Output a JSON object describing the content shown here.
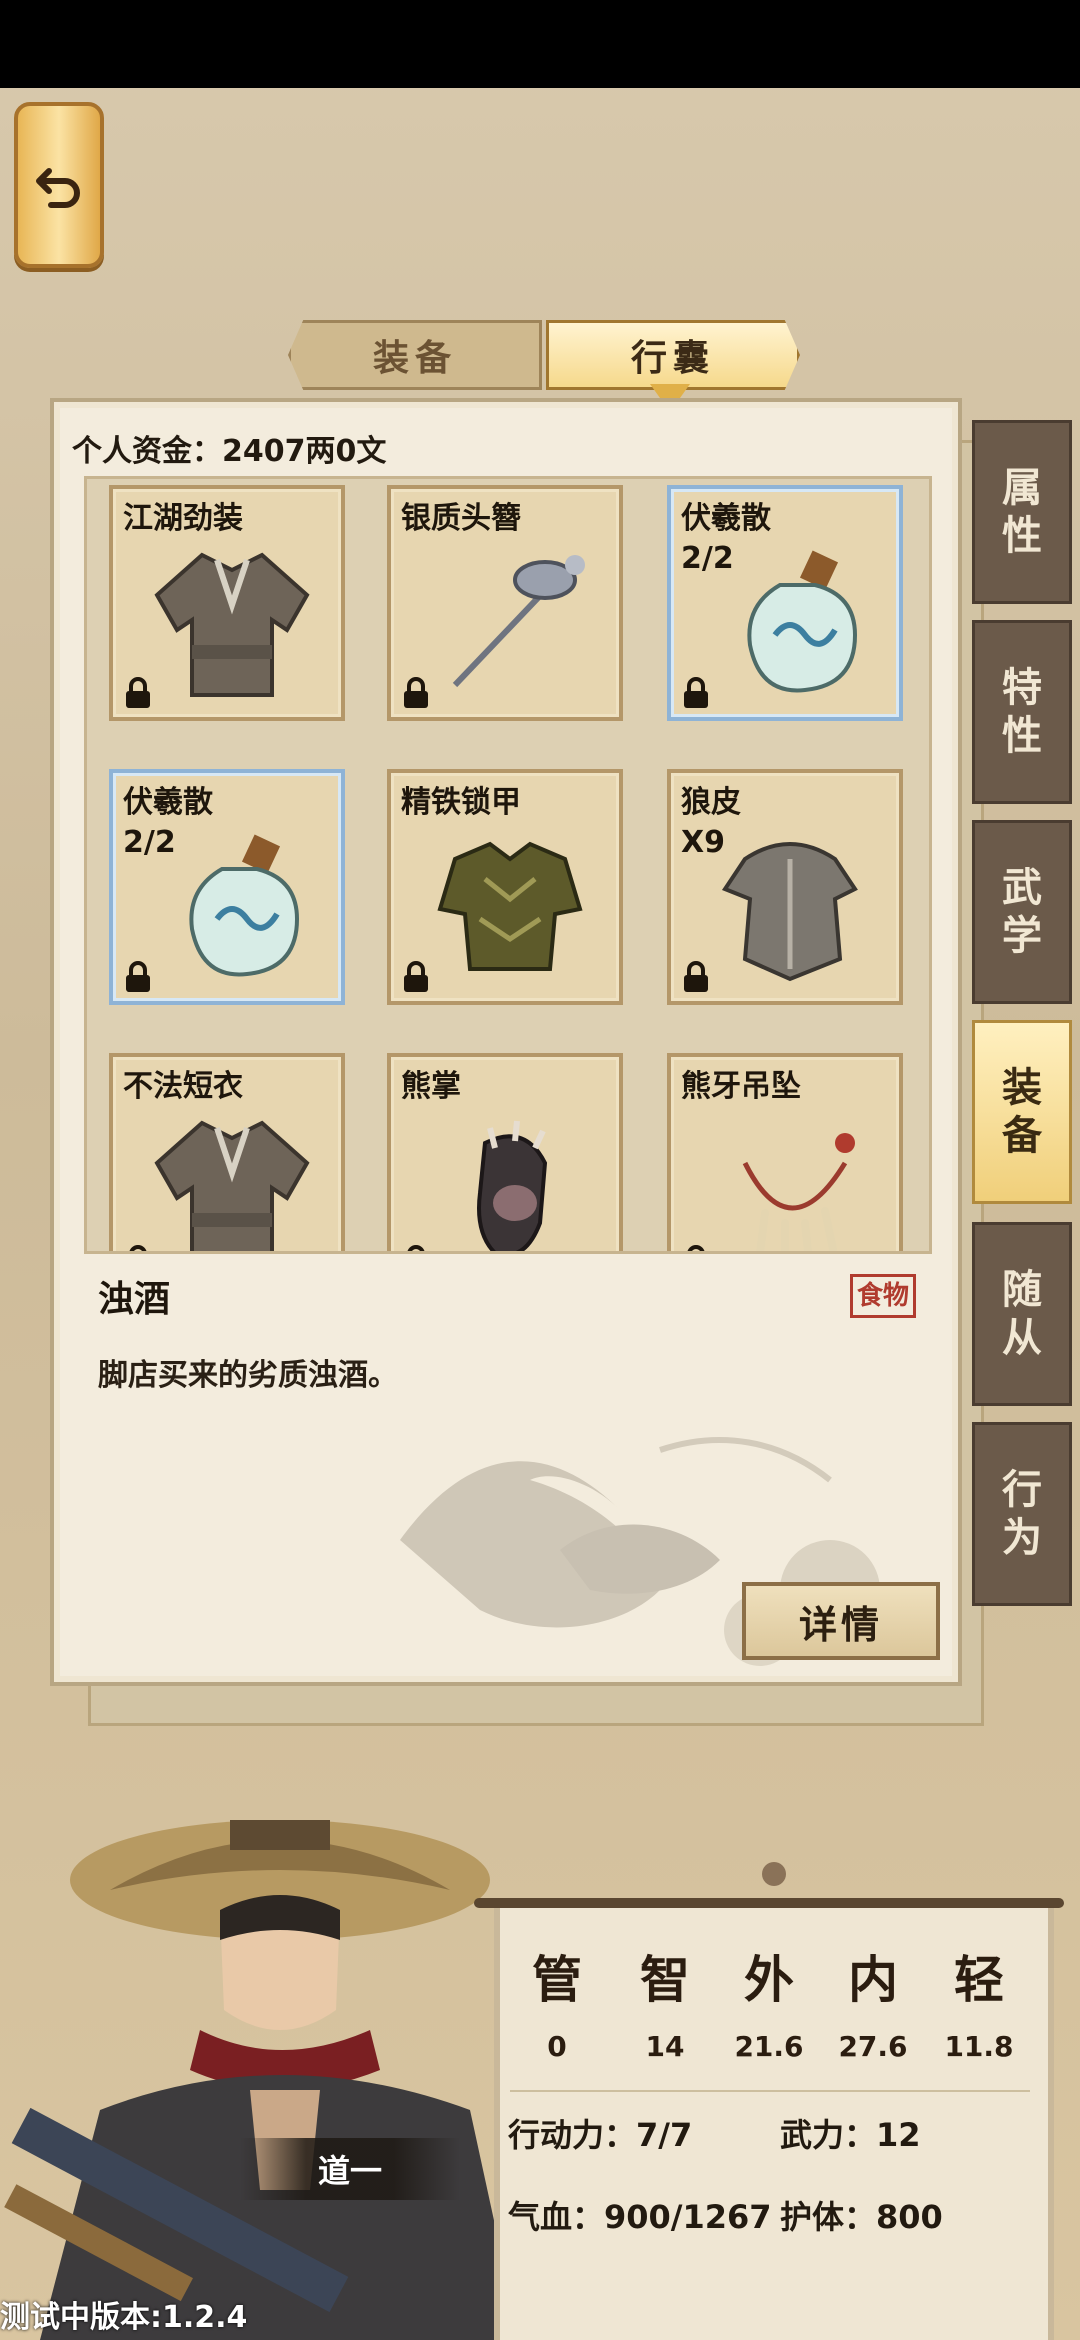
{
  "top_tabs": {
    "equip": "装备",
    "bag": "行囊"
  },
  "funds": "个人资金：2407两0文",
  "items": [
    {
      "name": "江湖劲装",
      "qty": "",
      "art": "robe"
    },
    {
      "name": "银质头簪",
      "qty": "",
      "art": "hairpin"
    },
    {
      "name": "伏羲散",
      "qty": "2/2",
      "art": "bottle",
      "selected": true
    },
    {
      "name": "伏羲散",
      "qty": "2/2",
      "art": "bottle",
      "selected": true
    },
    {
      "name": "精铁锁甲",
      "qty": "",
      "art": "armor"
    },
    {
      "name": "狼皮",
      "qty": "X9",
      "art": "pelt"
    },
    {
      "name": "不法短衣",
      "qty": "",
      "art": "robe"
    },
    {
      "name": "熊掌",
      "qty": "",
      "art": "paw"
    },
    {
      "name": "熊牙吊坠",
      "qty": "",
      "art": "necklace"
    }
  ],
  "detail": {
    "title": "浊酒",
    "badge": "食物",
    "text": "脚店买来的劣质浊酒。",
    "button": "详情"
  },
  "side_tabs": [
    {
      "label": "属性",
      "active": false
    },
    {
      "label": "特性",
      "active": false
    },
    {
      "label": "武学",
      "active": false
    },
    {
      "label": "装备",
      "active": true
    },
    {
      "label": "随从",
      "active": false
    },
    {
      "label": "行为",
      "active": false
    }
  ],
  "character": {
    "name": "道一"
  },
  "stats": [
    {
      "label": "管",
      "value": "0"
    },
    {
      "label": "智",
      "value": "14"
    },
    {
      "label": "外",
      "value": "21.6"
    },
    {
      "label": "内",
      "value": "27.6"
    },
    {
      "label": "轻",
      "value": "11.8"
    }
  ],
  "attributes": {
    "action": "行动力：7/7",
    "martial": "武力：12",
    "hp": "气血：900/1267",
    "guard": "护体：800"
  },
  "version": "测试中版本:1.2.4"
}
